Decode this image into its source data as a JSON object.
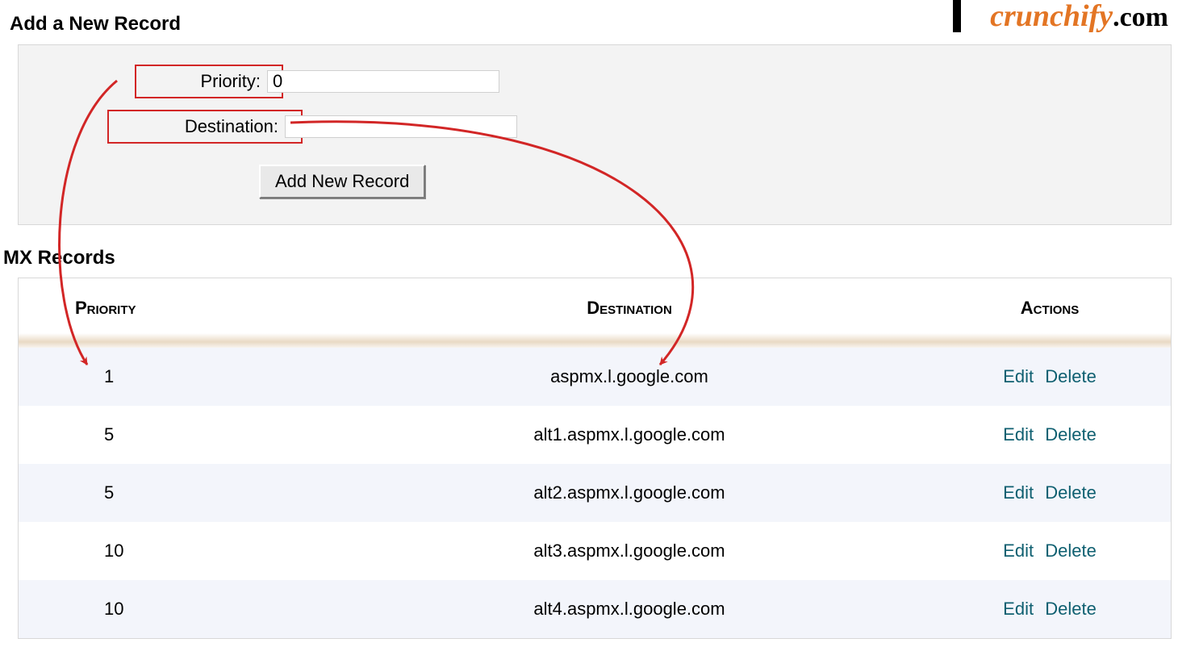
{
  "logo": {
    "crunchify": "crunchify",
    "dotcom": ".com"
  },
  "headings": {
    "add": "Add a New Record",
    "mx": "MX Records"
  },
  "form": {
    "priority_label": "Priority:",
    "priority_value": "0",
    "destination_label": "Destination:",
    "destination_value": "",
    "submit_label": "Add New Record"
  },
  "table": {
    "columns": {
      "priority": "Priority",
      "destination": "Destination",
      "actions": "Actions"
    },
    "action_edit": "Edit",
    "action_delete": "Delete",
    "rows": [
      {
        "priority": "1",
        "destination": "aspmx.l.google.com"
      },
      {
        "priority": "5",
        "destination": "alt1.aspmx.l.google.com"
      },
      {
        "priority": "5",
        "destination": "alt2.aspmx.l.google.com"
      },
      {
        "priority": "10",
        "destination": "alt3.aspmx.l.google.com"
      },
      {
        "priority": "10",
        "destination": "alt4.aspmx.l.google.com"
      }
    ]
  },
  "annotation_color": "#d22626"
}
